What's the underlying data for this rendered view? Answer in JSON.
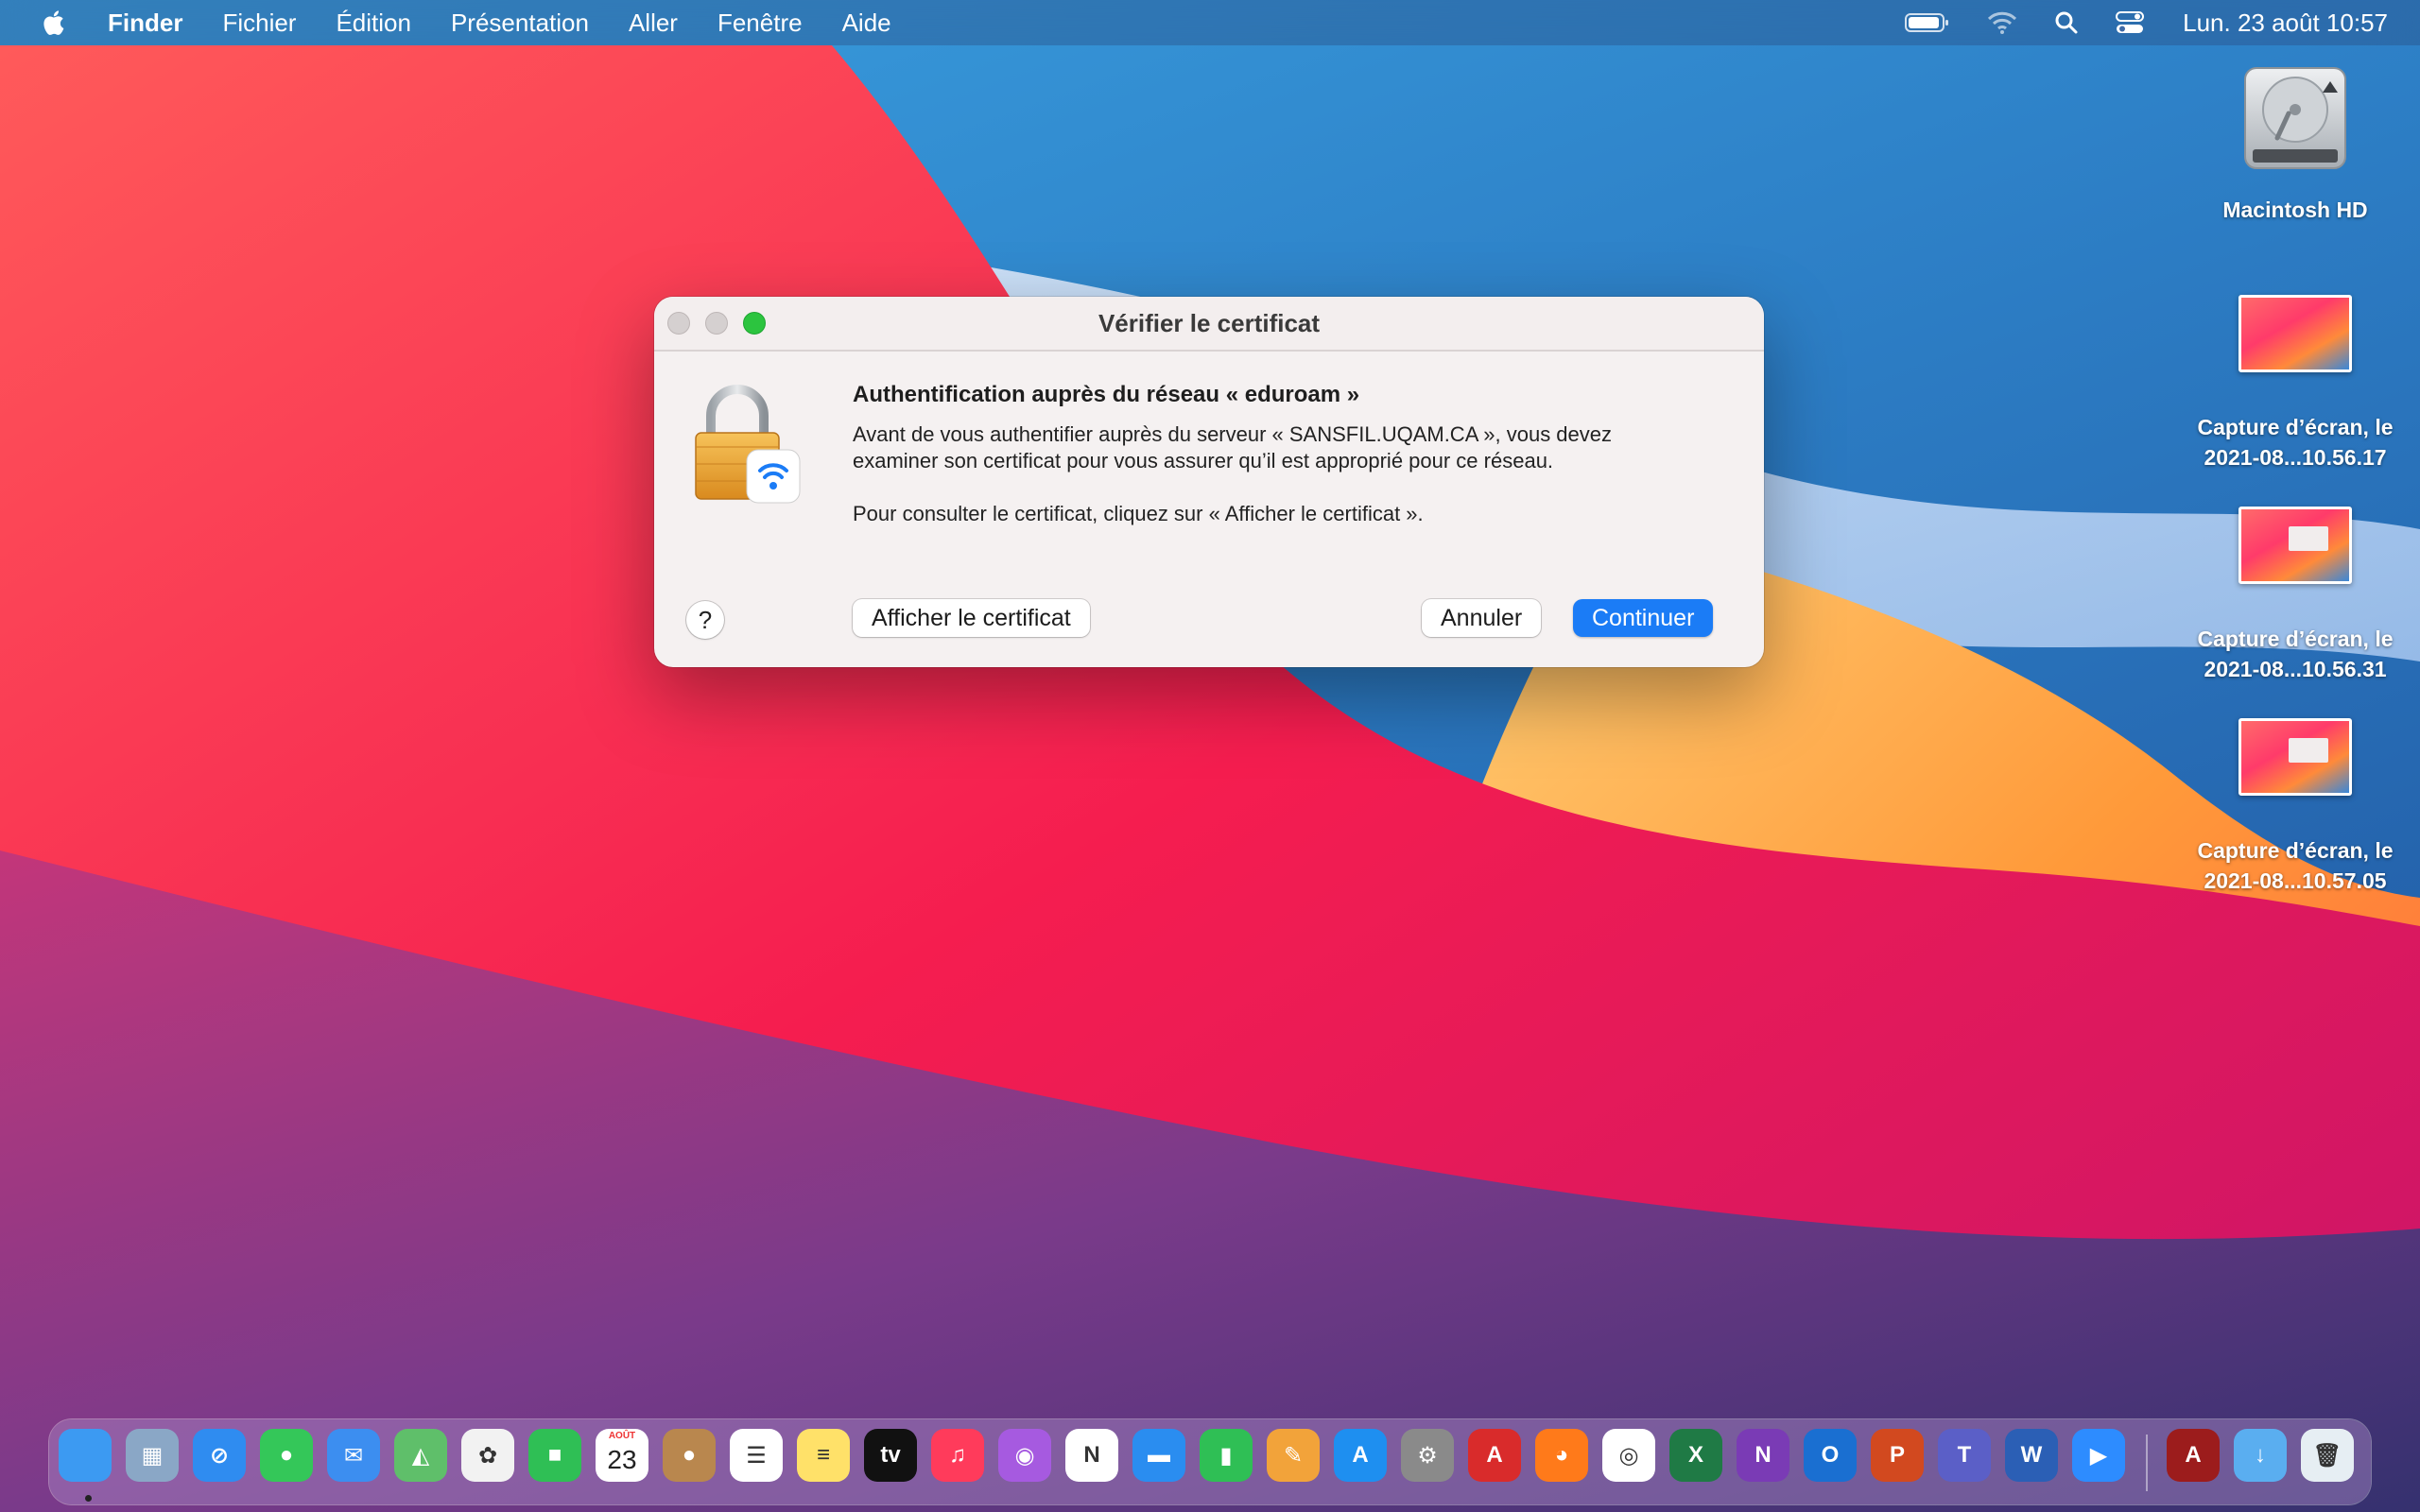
{
  "menubar": {
    "app_name": "Finder",
    "menus": [
      "Fichier",
      "Édition",
      "Présentation",
      "Aller",
      "Fenêtre",
      "Aide"
    ],
    "status_icons": [
      "battery-icon",
      "wifi-icon",
      "search-icon",
      "control-center-icon"
    ],
    "clock": "Lun. 23 août  10:57"
  },
  "desktop_icons": [
    {
      "label": "Macintosh HD",
      "icon": "hard-drive-icon"
    },
    {
      "label_line1": "Capture d’écran, le",
      "label_line2": "2021-08...10.56.17",
      "icon": "screenshot-thumbnail"
    },
    {
      "label_line1": "Capture d’écran, le",
      "label_line2": "2021-08...10.56.31",
      "icon": "screenshot-thumbnail"
    },
    {
      "label_line1": "Capture d’écran, le",
      "label_line2": "2021-08...10.57.05",
      "icon": "screenshot-thumbnail"
    }
  ],
  "dialog": {
    "title": "Vérifier le certificat",
    "heading": "Authentification auprès du réseau « eduroam »",
    "body_line1": "Avant de vous authentifier auprès du serveur « SANSFIL.UQAM.CA », vous devez",
    "body_line2": "examiner son certificat pour vous assurer qu’il est approprié pour ce réseau.",
    "body_hint": "Pour consulter le certificat, cliquez sur « Afficher le certificat ».",
    "help_label": "?",
    "show_cert_label": "Afficher le certificat",
    "cancel_label": "Annuler",
    "continue_label": "Continuer",
    "accent_color": "#1b7cf6"
  },
  "dock": {
    "apps": [
      {
        "name": "finder",
        "color": "#3c9af2",
        "glyph": ""
      },
      {
        "name": "launchpad",
        "color": "#8aa7c6",
        "glyph": "▦"
      },
      {
        "name": "safari",
        "color": "#2f8cf0",
        "glyph": "⊘"
      },
      {
        "name": "messages",
        "color": "#34c759",
        "glyph": "●"
      },
      {
        "name": "mail",
        "color": "#3c8ef0",
        "glyph": "✉"
      },
      {
        "name": "maps",
        "color": "#5fbf6a",
        "glyph": "◭"
      },
      {
        "name": "photos",
        "color": "#f2f2f2",
        "glyph": "✿"
      },
      {
        "name": "facetime",
        "color": "#2fbf55",
        "glyph": "■"
      },
      {
        "name": "calendar",
        "color": "#ffffff",
        "glyph": "23",
        "month": "AOÛT"
      },
      {
        "name": "contacts",
        "color": "#b9874e",
        "glyph": "●"
      },
      {
        "name": "reminders",
        "color": "#ffffff",
        "glyph": "☰"
      },
      {
        "name": "notes",
        "color": "#ffe169",
        "glyph": "≡"
      },
      {
        "name": "apple-tv",
        "color": "#111111",
        "glyph": "tv"
      },
      {
        "name": "music",
        "color": "#ff3b5b",
        "glyph": "♫"
      },
      {
        "name": "podcasts",
        "color": "#a65ae0",
        "glyph": "◉"
      },
      {
        "name": "news",
        "color": "#ffffff",
        "glyph": "N"
      },
      {
        "name": "keynote",
        "color": "#2a8df0",
        "glyph": "▬"
      },
      {
        "name": "numbers",
        "color": "#2fbf55",
        "glyph": "▮"
      },
      {
        "name": "pages",
        "color": "#f2a33a",
        "glyph": "✎"
      },
      {
        "name": "app-store",
        "color": "#1e8ff0",
        "glyph": "A"
      },
      {
        "name": "system-preferences",
        "color": "#8a8a8a",
        "glyph": "⚙"
      },
      {
        "name": "acrobat-reader",
        "color": "#d92b2b",
        "glyph": "A"
      },
      {
        "name": "firefox",
        "color": "#ff7a1a",
        "glyph": "◕"
      },
      {
        "name": "chrome",
        "color": "#ffffff",
        "glyph": "◎"
      },
      {
        "name": "excel",
        "color": "#1f7a45",
        "glyph": "X"
      },
      {
        "name": "onenote",
        "color": "#7a3bb5",
        "glyph": "N"
      },
      {
        "name": "outlook",
        "color": "#1a6fd1",
        "glyph": "O"
      },
      {
        "name": "powerpoint",
        "color": "#d2491f",
        "glyph": "P"
      },
      {
        "name": "teams",
        "color": "#5b5fc7",
        "glyph": "T"
      },
      {
        "name": "word",
        "color": "#2b5fb5",
        "glyph": "W"
      },
      {
        "name": "zoom",
        "color": "#2d8cff",
        "glyph": "▶"
      }
    ],
    "right_items": [
      {
        "name": "acrobat-document",
        "color": "#9c1c1c",
        "glyph": "A"
      },
      {
        "name": "downloads-folder",
        "color": "#5aaef0",
        "glyph": "↓"
      },
      {
        "name": "trash",
        "color": "#e6eef3",
        "glyph": "🗑"
      }
    ]
  }
}
